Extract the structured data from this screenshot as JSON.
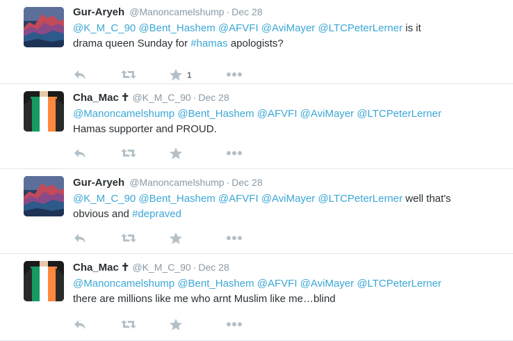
{
  "tweets": [
    {
      "name": "Gur-Aryeh",
      "badge": "",
      "handle": "@Manoncamelshump",
      "sep": "·",
      "time": "Dec 28",
      "avatar": "landscape",
      "line1": [
        {
          "t": "@K_M_C_90",
          "k": "mention"
        },
        {
          "t": " ",
          "k": "text"
        },
        {
          "t": "@Bent_Hashem",
          "k": "mention"
        },
        {
          "t": " ",
          "k": "text"
        },
        {
          "t": "@AFVFI",
          "k": "mention"
        },
        {
          "t": " ",
          "k": "text"
        },
        {
          "t": "@AviMayer",
          "k": "mention"
        },
        {
          "t": " ",
          "k": "text"
        },
        {
          "t": "@LTCPeterLerner",
          "k": "mention"
        },
        {
          "t": " is it",
          "k": "text"
        }
      ],
      "line2": [
        {
          "t": "drama queen Sunday for ",
          "k": "text"
        },
        {
          "t": "#hamas",
          "k": "hashtag"
        },
        {
          "t": " apologists?",
          "k": "text"
        }
      ],
      "fav_count": "1"
    },
    {
      "name": "Cha_Mac",
      "badge": "✝",
      "handle": "@K_M_C_90",
      "sep": "·",
      "time": "Dec 28",
      "avatar": "irish",
      "line1": [
        {
          "t": "@Manoncamelshump",
          "k": "mention"
        },
        {
          "t": " ",
          "k": "text"
        },
        {
          "t": "@Bent_Hashem",
          "k": "mention"
        },
        {
          "t": " ",
          "k": "text"
        },
        {
          "t": "@AFVFI",
          "k": "mention"
        },
        {
          "t": " ",
          "k": "text"
        },
        {
          "t": "@AviMayer",
          "k": "mention"
        },
        {
          "t": " ",
          "k": "text"
        },
        {
          "t": "@LTCPeterLerner",
          "k": "mention"
        }
      ],
      "line2": [
        {
          "t": "Hamas supporter and PROUD.",
          "k": "text"
        }
      ],
      "fav_count": ""
    },
    {
      "name": "Gur-Aryeh",
      "badge": "",
      "handle": "@Manoncamelshump",
      "sep": "·",
      "time": "Dec 28",
      "avatar": "landscape",
      "line1": [
        {
          "t": "@K_M_C_90",
          "k": "mention"
        },
        {
          "t": " ",
          "k": "text"
        },
        {
          "t": "@Bent_Hashem",
          "k": "mention"
        },
        {
          "t": " ",
          "k": "text"
        },
        {
          "t": "@AFVFI",
          "k": "mention"
        },
        {
          "t": " ",
          "k": "text"
        },
        {
          "t": "@AviMayer",
          "k": "mention"
        },
        {
          "t": " ",
          "k": "text"
        },
        {
          "t": "@LTCPeterLerner",
          "k": "mention"
        },
        {
          "t": " well that's",
          "k": "text"
        }
      ],
      "line2": [
        {
          "t": "obvious and ",
          "k": "text"
        },
        {
          "t": "#depraved",
          "k": "hashtag"
        }
      ],
      "fav_count": ""
    },
    {
      "name": "Cha_Mac",
      "badge": "✝",
      "handle": "@K_M_C_90",
      "sep": "·",
      "time": "Dec 28",
      "avatar": "irish",
      "line1": [
        {
          "t": "@Manoncamelshump",
          "k": "mention"
        },
        {
          "t": " ",
          "k": "text"
        },
        {
          "t": "@Bent_Hashem",
          "k": "mention"
        },
        {
          "t": " ",
          "k": "text"
        },
        {
          "t": "@AFVFI",
          "k": "mention"
        },
        {
          "t": " ",
          "k": "text"
        },
        {
          "t": "@AviMayer",
          "k": "mention"
        },
        {
          "t": " ",
          "k": "text"
        },
        {
          "t": "@LTCPeterLerner",
          "k": "mention"
        }
      ],
      "line2": [
        {
          "t": "there are millions like me who arnt Muslim like me…blind",
          "k": "text"
        }
      ],
      "fav_count": ""
    }
  ],
  "icons": {
    "reply": "reply-icon",
    "retweet": "retweet-icon",
    "favorite": "star-icon",
    "more": "more-dots-icon"
  },
  "colors": {
    "link": "#3aa7d6",
    "icon": "#b4c0c8",
    "meta": "#8899a6",
    "divider": "#e1e8ed"
  }
}
